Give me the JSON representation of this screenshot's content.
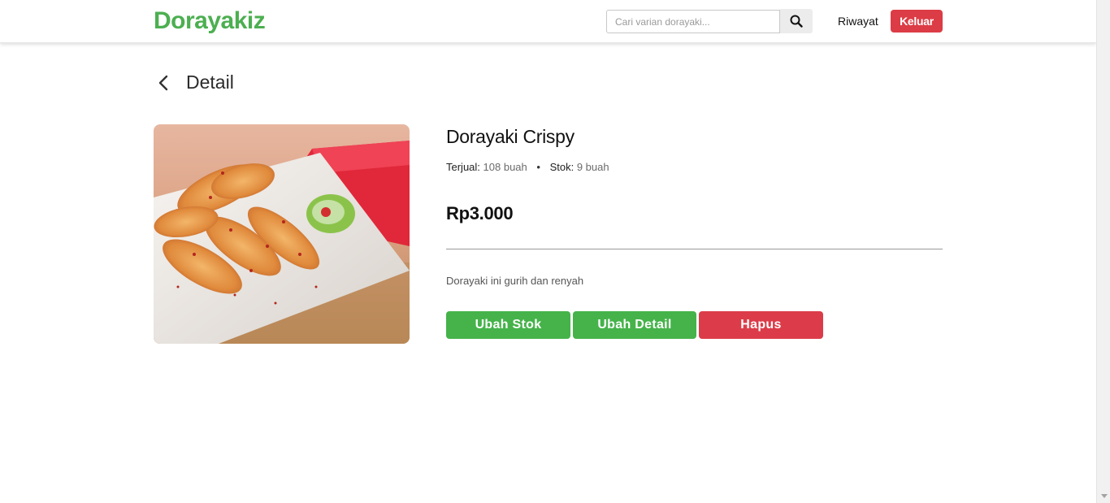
{
  "navbar": {
    "brand": "Dorayakiz",
    "search_placeholder": "Cari varian dorayaki...",
    "history_link": "Riwayat",
    "logout_label": "Keluar"
  },
  "page": {
    "title": "Detail"
  },
  "product": {
    "name": "Dorayaki Crispy",
    "sold_label": "Terjual:",
    "sold_value": "108 buah",
    "separator": "•",
    "stock_label": "Stok:",
    "stock_value": "9 buah",
    "price": "Rp3.000",
    "description": "Dorayaki ini gurih dan renyah"
  },
  "actions": {
    "edit_stock": "Ubah Stok",
    "edit_detail": "Ubah Detail",
    "delete": "Hapus"
  },
  "colors": {
    "brand": "#4caf50",
    "danger": "#dc3c49",
    "success": "#45b34a"
  }
}
